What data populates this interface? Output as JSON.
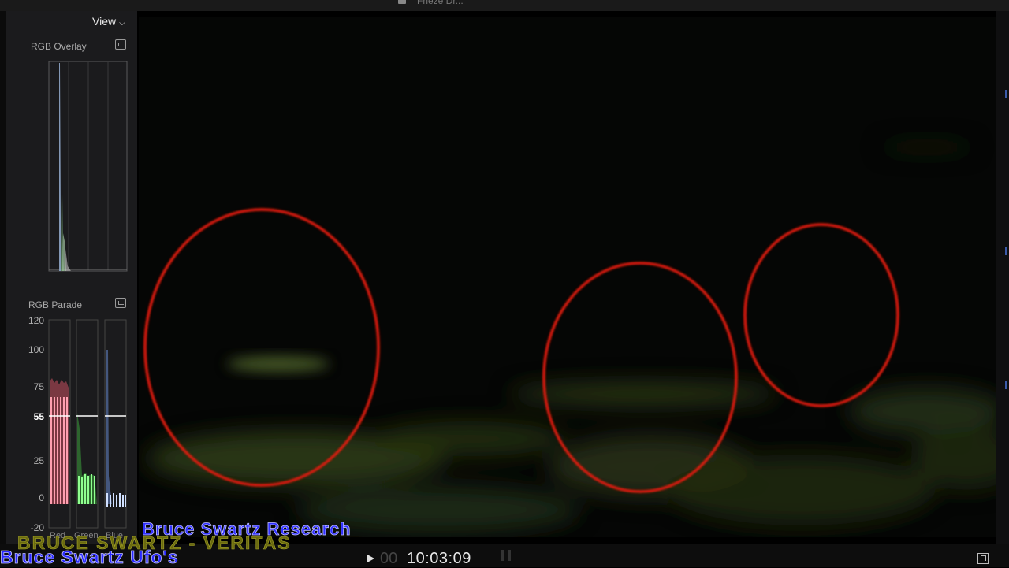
{
  "window": {
    "title": "Frieze Dr..."
  },
  "scopes": {
    "view_label": "View",
    "overlay": {
      "title": "RGB Overlay"
    },
    "parade": {
      "title": "RGB Parade",
      "scale": [
        "120",
        "100",
        "75",
        "55",
        "25",
        "0",
        "-20"
      ],
      "highlight_value": "55",
      "channels": [
        "Red",
        "Green",
        "Blue"
      ],
      "channel_colors": {
        "red": "#e06070",
        "green": "#50d050",
        "blue": "#7090e0"
      }
    }
  },
  "viewer": {
    "timecode": "10:03:09",
    "timecode_prefix": "00",
    "annotation_color": "#e01a10"
  },
  "watermarks": {
    "research": "Bruce Swartz Research",
    "veritas": "BRUCE SWARTZ - VERITAS",
    "ufos": "Bruce Swartz Ufo's"
  }
}
